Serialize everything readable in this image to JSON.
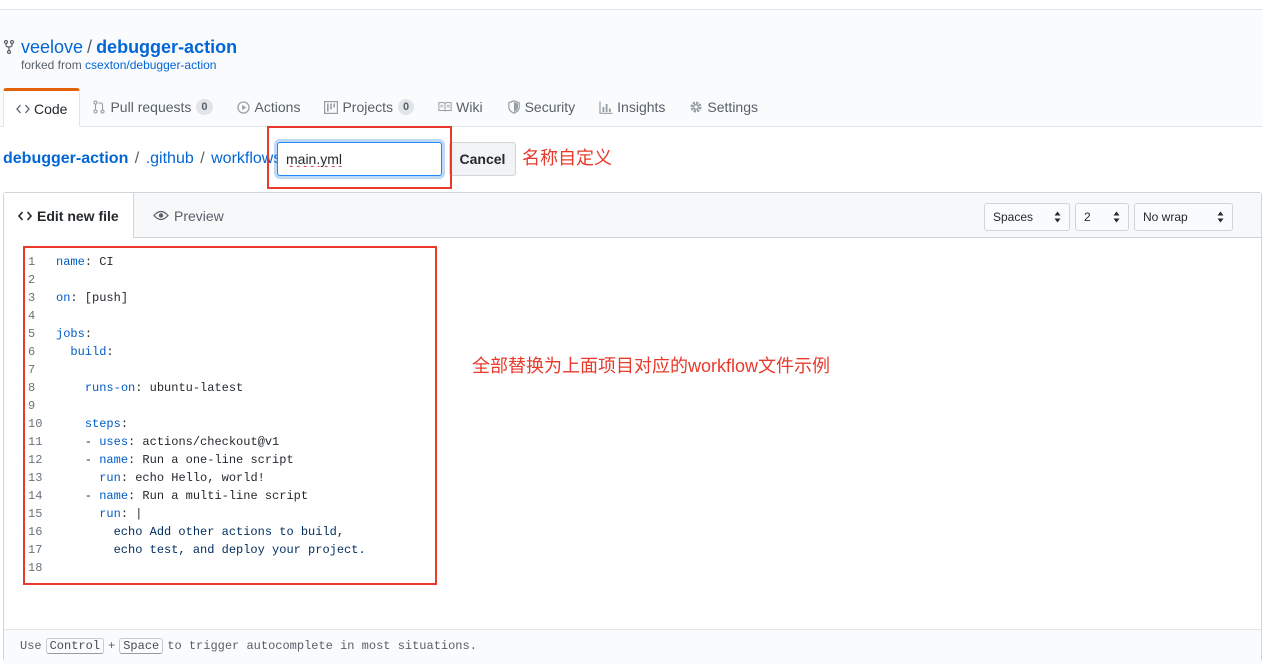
{
  "repo": {
    "owner": "veelove",
    "separator": "/",
    "name": "debugger-action",
    "forked_prefix": "forked from",
    "forked_source": "csexton/debugger-action"
  },
  "tabs": [
    {
      "label": "Code",
      "count": null
    },
    {
      "label": "Pull requests",
      "count": "0"
    },
    {
      "label": "Actions",
      "count": null
    },
    {
      "label": "Projects",
      "count": "0"
    },
    {
      "label": "Wiki",
      "count": null
    },
    {
      "label": "Security",
      "count": null
    },
    {
      "label": "Insights",
      "count": null
    },
    {
      "label": "Settings",
      "count": null
    }
  ],
  "breadcrumb": {
    "root": "debugger-action",
    "sep": "/",
    "dir1": ".github",
    "dir2": "workflows"
  },
  "filename": {
    "value": "main.yml"
  },
  "cancel_label": "Cancel",
  "annotations": {
    "name_note": "名称自定义",
    "code_note": "全部替换为上面项目对应的workflow文件示例"
  },
  "editor": {
    "tab_edit": "Edit new file",
    "tab_preview": "Preview",
    "indent_mode": "Spaces",
    "indent_size": "2",
    "wrap_mode": "No wrap",
    "lines": [
      {
        "n": "1",
        "t": "name: CI"
      },
      {
        "n": "2",
        "t": ""
      },
      {
        "n": "3",
        "t": "on: [push]"
      },
      {
        "n": "4",
        "t": ""
      },
      {
        "n": "5",
        "t": "jobs:"
      },
      {
        "n": "6",
        "t": "  build:"
      },
      {
        "n": "7",
        "t": ""
      },
      {
        "n": "8",
        "t": "    runs-on: ubuntu-latest"
      },
      {
        "n": "9",
        "t": ""
      },
      {
        "n": "10",
        "t": "    steps:"
      },
      {
        "n": "11",
        "t": "    - uses: actions/checkout@v1"
      },
      {
        "n": "12",
        "t": "    - name: Run a one-line script"
      },
      {
        "n": "13",
        "t": "      run: echo Hello, world!"
      },
      {
        "n": "14",
        "t": "    - name: Run a multi-line script"
      },
      {
        "n": "15",
        "t": "      run: |"
      },
      {
        "n": "16",
        "t": "        echo Add other actions to build,"
      },
      {
        "n": "17",
        "t": "        echo test, and deploy your project."
      },
      {
        "n": "18",
        "t": ""
      }
    ],
    "footer": {
      "before": "Use",
      "key1": "Control",
      "plus": "+",
      "key2": "Space",
      "after": "to trigger autocomplete in most situations."
    }
  },
  "colors": {
    "link": "#0366d6",
    "annotation": "#e8392b",
    "tab_accent": "#e36209"
  }
}
